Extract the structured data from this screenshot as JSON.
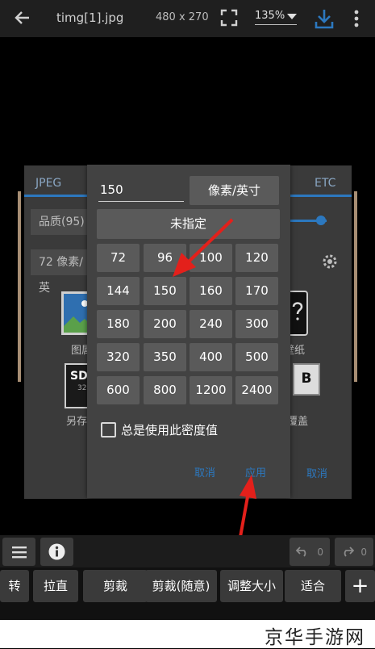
{
  "topbar": {
    "filename": "timg[1].jpg",
    "dimensions": "480 x 270",
    "zoom": "135%"
  },
  "background_dialog": {
    "tab_left": "JPEG",
    "tab_right": "ETC",
    "quality_label": "品质(95)",
    "ppi_label": "72 像素/英",
    "icon1_label": "图属",
    "icon2_label": "另存",
    "wallpaper_label": "壁纸",
    "overwrite_label": "覆盖",
    "cancel": "取消",
    "sd_text": "SD",
    "sd_sub": "32",
    "b_text": "B"
  },
  "dpi_dialog": {
    "input_value": "150",
    "unit_button": "像素/英寸",
    "unspecified": "未指定",
    "grid": [
      "72",
      "96",
      "100",
      "120",
      "144",
      "150",
      "160",
      "170",
      "180",
      "200",
      "240",
      "300",
      "320",
      "350",
      "400",
      "500",
      "600",
      "800",
      "1200",
      "2400"
    ],
    "checkbox_label": "总是使用此密度值",
    "checkbox_checked": false,
    "cancel": "取消",
    "apply": "应用"
  },
  "toolbar": {
    "undo_count": "0",
    "redo_count": "0",
    "buttons": [
      "转",
      "拉直",
      "剪裁",
      "剪裁(随意)",
      "调整大小",
      "适合"
    ],
    "add": "+"
  },
  "watermark": "京华手游网",
  "colors": {
    "accent": "#2c78bf",
    "annotation_arrow": "#e3201b"
  }
}
